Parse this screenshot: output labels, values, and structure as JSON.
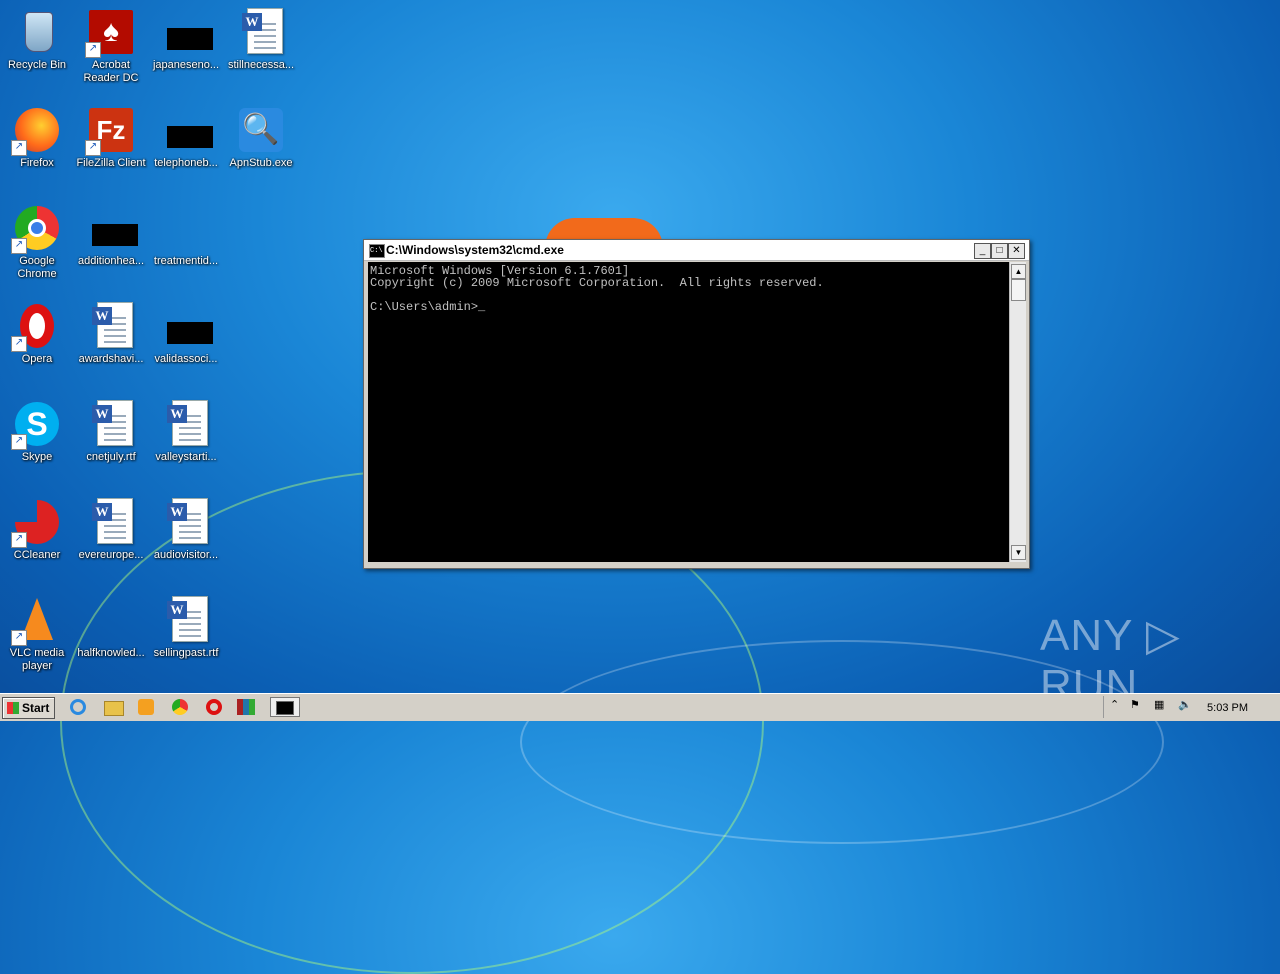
{
  "desktop": {
    "icons": [
      {
        "label": "Recycle Bin",
        "kind": "recycle-bin"
      },
      {
        "label": "Acrobat Reader DC",
        "kind": "acrobat"
      },
      {
        "label": "japaneseno...",
        "kind": "black"
      },
      {
        "label": "stillnecessa...",
        "kind": "word"
      },
      {
        "label": "Firefox",
        "kind": "firefox"
      },
      {
        "label": "FileZilla Client",
        "kind": "filezilla"
      },
      {
        "label": "telephoneb...",
        "kind": "black"
      },
      {
        "label": "ApnStub.exe",
        "kind": "search"
      },
      {
        "label": "Google Chrome",
        "kind": "chrome"
      },
      {
        "label": "additionhea...",
        "kind": "black"
      },
      {
        "label": "treatmentid...",
        "kind": "blank"
      },
      {
        "label": "Opera",
        "kind": "opera"
      },
      {
        "label": "awardshavi...",
        "kind": "word"
      },
      {
        "label": "validassoci...",
        "kind": "black"
      },
      {
        "label": "Skype",
        "kind": "skype"
      },
      {
        "label": "cnetjuly.rtf",
        "kind": "word"
      },
      {
        "label": "valleystarti...",
        "kind": "word"
      },
      {
        "label": "CCleaner",
        "kind": "ccleaner"
      },
      {
        "label": "evereurope...",
        "kind": "word"
      },
      {
        "label": "audiovisitor...",
        "kind": "word"
      },
      {
        "label": "VLC media player",
        "kind": "vlc"
      },
      {
        "label": "halfknowled...",
        "kind": "blank"
      },
      {
        "label": "sellingpast.rtf",
        "kind": "word"
      }
    ]
  },
  "cmd_window": {
    "title": "C:\\Windows\\system32\\cmd.exe",
    "lines": [
      "Microsoft Windows [Version 6.1.7601]",
      "Copyright (c) 2009 Microsoft Corporation.  All rights reserved.",
      "",
      "C:\\Users\\admin>_"
    ],
    "minimize": "_",
    "maximize": "□",
    "close": "✕"
  },
  "taskbar": {
    "start_label": "Start",
    "clock": "5:03 PM",
    "pinned": [
      "ie-icon",
      "explorer-icon",
      "media-player-icon",
      "chrome-icon",
      "opera-icon",
      "winrar-icon",
      "cmd-icon"
    ]
  },
  "watermark": "ANY ▷ RUN",
  "colors": {
    "desktop": "#1a86d6",
    "taskbar": "#d4d0c8",
    "console_bg": "#000000",
    "console_fg": "#c0c0c0"
  }
}
